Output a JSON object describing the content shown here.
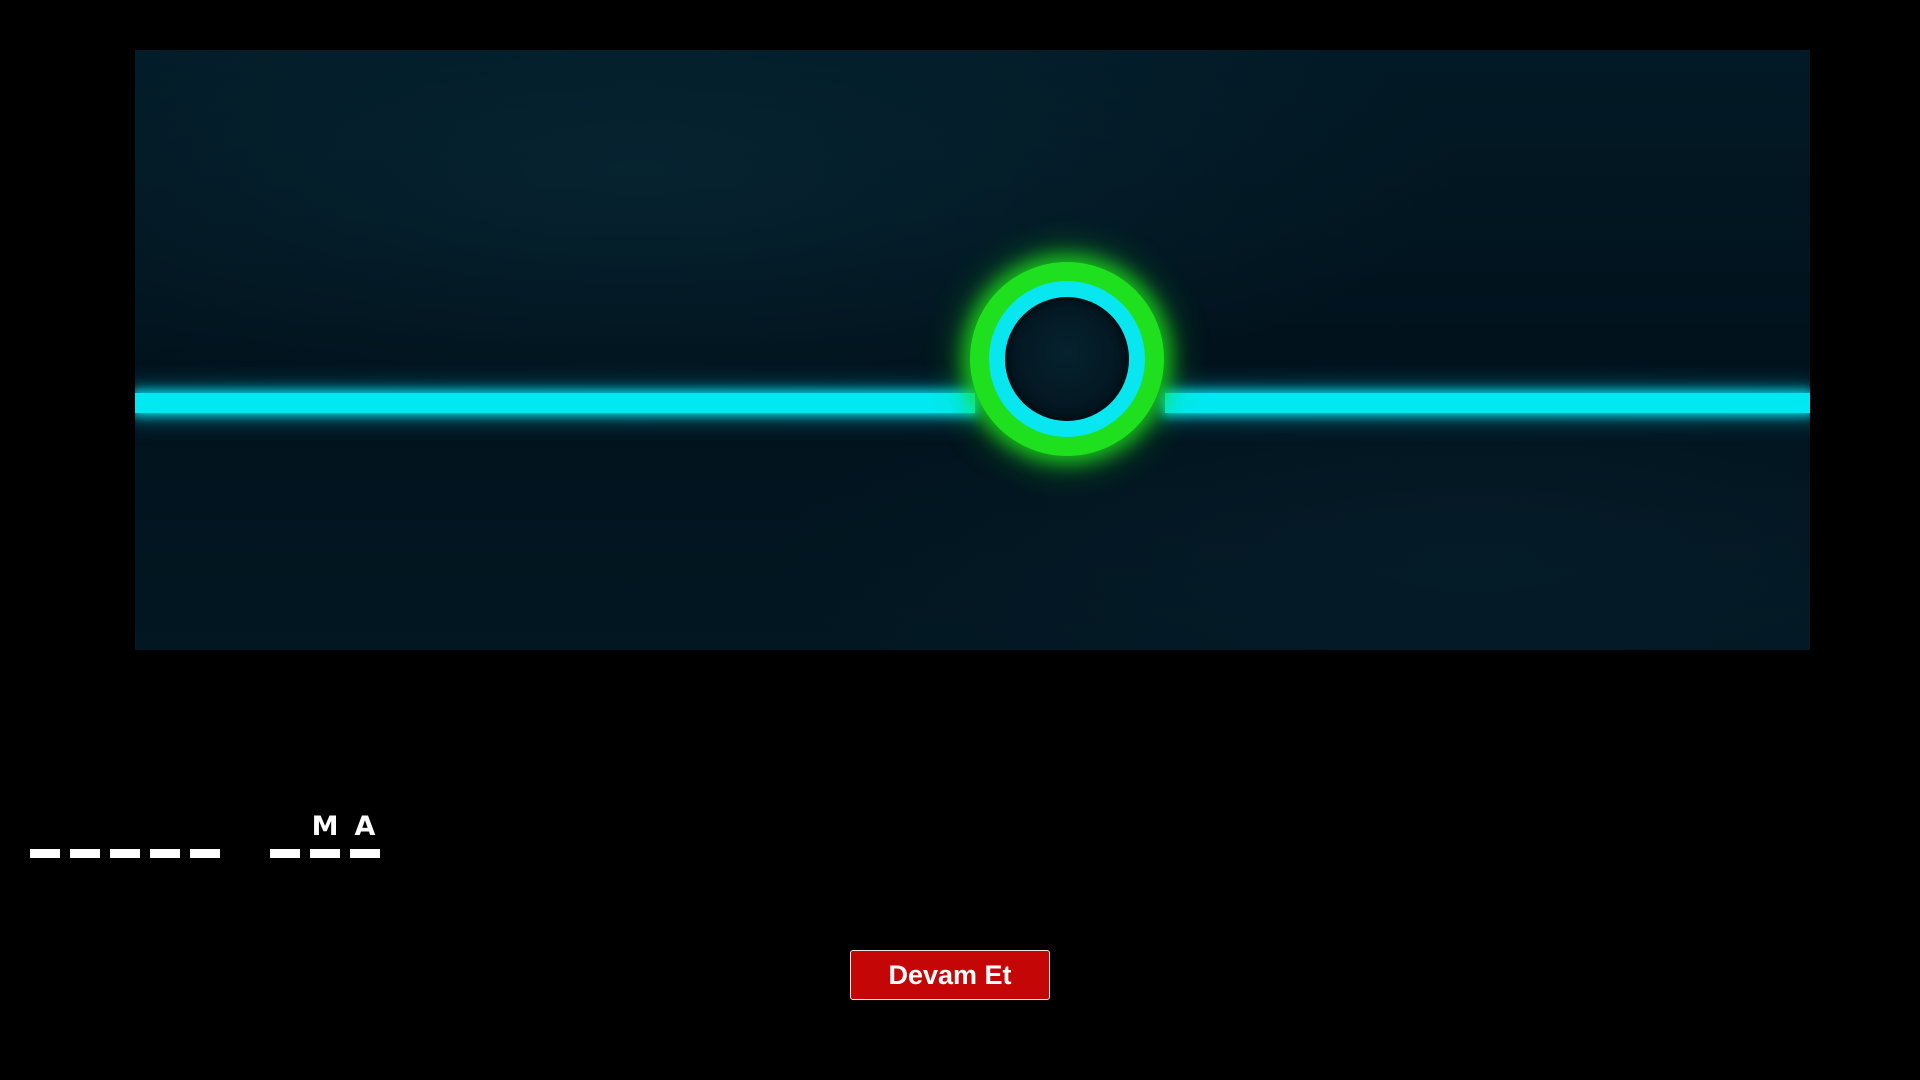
{
  "game": {
    "colors": {
      "background": "#000000",
      "panel": "#021722",
      "laser": "#00e8f2",
      "ring_outer": "#1ee01e",
      "ring_inner": "#08e6f0",
      "button": "#c40606"
    }
  },
  "word": {
    "slots": [
      "",
      "",
      "",
      "",
      "",
      "",
      "M",
      "A"
    ]
  },
  "continue_button": {
    "label": "Devam Et"
  }
}
